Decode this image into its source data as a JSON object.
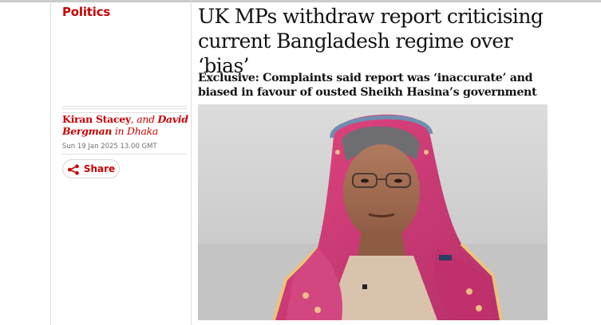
{
  "article": {
    "section": "Politics",
    "headline": "UK MPs withdraw report criticising current Bangladesh regime over ‘bias’",
    "standfirst": "Exclusive: Complaints said report was ‘inaccurate’ and biased in favour of ousted Sheikh Hasina’s government",
    "byline": {
      "author_1": "Kiran Stacey",
      "conjunction": ", and ",
      "author_2": "David Bergman",
      "location": " in Dhaka"
    },
    "date": "Sun 19 Jan 2025 13.00 GMT",
    "share_label": "Share",
    "share_icon": "share-icon"
  },
  "colors": {
    "accent": "#c70000",
    "text": "#121212",
    "meta": "#707070",
    "rule": "#dcdcdc"
  }
}
